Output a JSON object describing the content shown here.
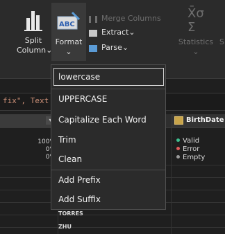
{
  "ribbon": {
    "split_column_label_1": "Split",
    "split_column_label_2": "Column",
    "format_label": "Format",
    "merge_columns_label": "Merge Columns",
    "extract_label": "Extract",
    "parse_label": "Parse",
    "statistics_label": "Statistics"
  },
  "formula": {
    "text": "fix\", Text"
  },
  "header": {
    "birthdate_label": "BirthDate"
  },
  "quality": {
    "valid_pct": "100%",
    "error_pct": "0%",
    "empty_pct": "0%",
    "valid_label": "Valid",
    "error_label": "Error",
    "empty_label": "Empty",
    "valid_color": "#3fbf8f",
    "error_color": "#e05a5a",
    "empty_color": "#9a9a9a"
  },
  "rows": {
    "row1": "TORRES",
    "row2": "ZHU"
  },
  "format_menu": {
    "items": [
      "lowercase",
      "UPPERCASE",
      "Capitalize Each Word",
      "Trim",
      "Clean",
      "Add Prefix",
      "Add Suffix"
    ],
    "selected": "lowercase"
  }
}
